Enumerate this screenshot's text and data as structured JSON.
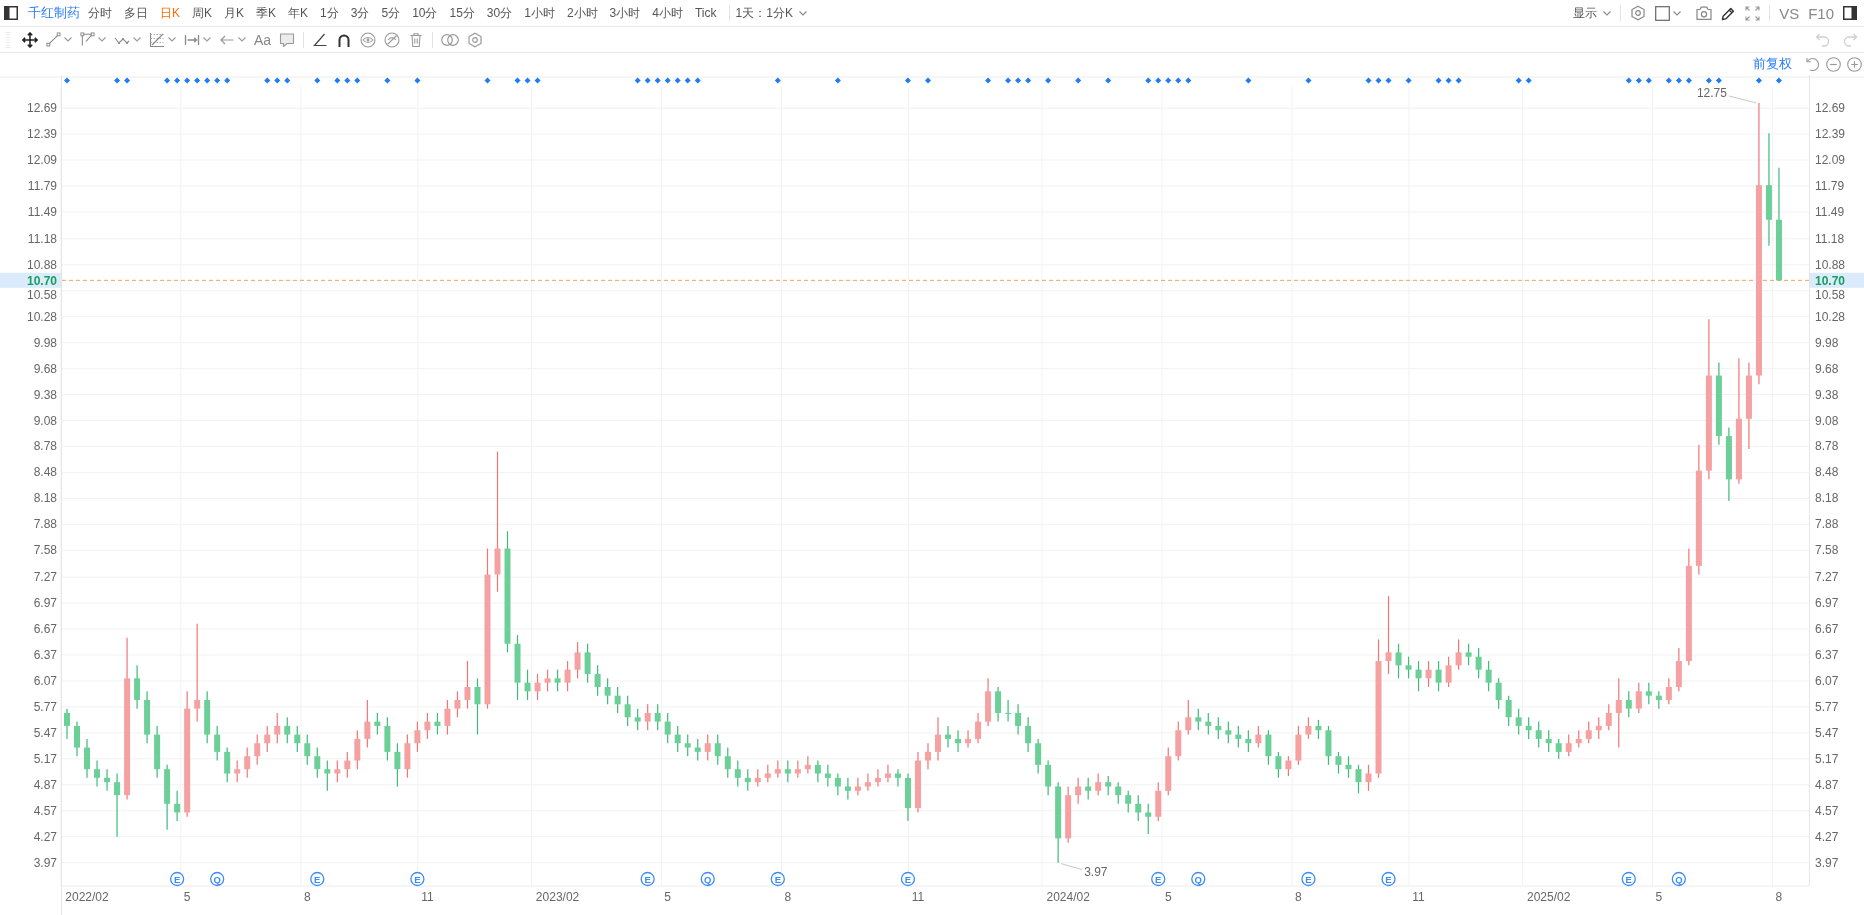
{
  "toolbar": {
    "stock_name": "千红制药",
    "periods": [
      {
        "label": "分时",
        "selected": false
      },
      {
        "label": "多日",
        "selected": false
      },
      {
        "label": "日K",
        "selected": true
      },
      {
        "label": "周K",
        "selected": false
      },
      {
        "label": "月K",
        "selected": false
      },
      {
        "label": "季K",
        "selected": false
      },
      {
        "label": "年K",
        "selected": false
      },
      {
        "label": "1分",
        "selected": false
      },
      {
        "label": "3分",
        "selected": false
      },
      {
        "label": "5分",
        "selected": false
      },
      {
        "label": "10分",
        "selected": false
      },
      {
        "label": "15分",
        "selected": false
      },
      {
        "label": "30分",
        "selected": false
      },
      {
        "label": "1小时",
        "selected": false
      },
      {
        "label": "2小时",
        "selected": false
      },
      {
        "label": "3小时",
        "selected": false
      },
      {
        "label": "4小时",
        "selected": false
      },
      {
        "label": "Tick",
        "selected": false
      }
    ],
    "interval_select": "1天：1分K",
    "display_menu": "显示",
    "compare_label": "VS",
    "f10_label": "F10"
  },
  "drawing_toolbar": {
    "text_tool": "Aa",
    "undo": {
      "disabled": true
    },
    "redo": {
      "disabled": true
    }
  },
  "chart": {
    "adjustment": "前复权",
    "left_axis_labels": [
      "12.69",
      "12.39",
      "12.09",
      "11.79",
      "11.49",
      "11.18",
      "10.88",
      "10.58",
      "10.28",
      "9.98",
      "9.68",
      "9.38",
      "9.08",
      "8.78",
      "8.48",
      "8.18",
      "7.88",
      "7.58",
      "7.27",
      "6.97",
      "6.67",
      "6.37",
      "6.07",
      "5.77",
      "5.47",
      "5.17",
      "4.87",
      "4.57",
      "4.27",
      "3.97"
    ],
    "right_axis_labels": [
      "12.69",
      "12.39",
      "12.09",
      "11.79",
      "11.49",
      "11.18",
      "10.88",
      "10.58",
      "10.28",
      "9.98",
      "9.68",
      "9.38",
      "9.08",
      "8.78",
      "8.48",
      "8.18",
      "7.88",
      "7.58",
      "7.27",
      "6.97",
      "6.67",
      "6.37",
      "6.07",
      "5.77",
      "5.47",
      "5.17",
      "4.87",
      "4.57",
      "4.27",
      "3.97"
    ],
    "left_price_tag": "10.70",
    "right_price_tag": "10.70",
    "event_row": [
      {
        "dot": true
      },
      {
        "dot": false
      },
      {
        "dot": false
      },
      {
        "dot": false
      },
      {
        "dot": false
      },
      {
        "dot": true
      },
      {
        "dot": true
      },
      {
        "dot": false
      },
      {
        "dot": false
      },
      {
        "dot": false
      },
      {
        "dot": true
      },
      {
        "dot": true,
        "badge": "E"
      },
      {
        "dot": true
      },
      {
        "dot": true
      },
      {
        "dot": true
      },
      {
        "dot": true,
        "badge": "Q"
      },
      {
        "dot": true
      },
      {
        "dot": false
      },
      {
        "dot": false
      },
      {
        "dot": false
      },
      {
        "dot": true
      },
      {
        "dot": true
      },
      {
        "dot": true
      },
      {
        "dot": false
      },
      {
        "dot": false
      },
      {
        "dot": true,
        "badge": "E"
      },
      {
        "dot": false
      },
      {
        "dot": true
      },
      {
        "dot": true
      },
      {
        "dot": true
      },
      {
        "dot": false
      },
      {
        "dot": false
      },
      {
        "dot": true
      },
      {
        "dot": false
      },
      {
        "dot": false
      },
      {
        "dot": true,
        "badge": "E"
      },
      {
        "dot": false
      },
      {
        "dot": false
      },
      {
        "dot": false
      },
      {
        "dot": false
      },
      {
        "dot": false
      },
      {
        "dot": false
      },
      {
        "dot": true
      },
      {
        "dot": false
      },
      {
        "dot": false
      },
      {
        "dot": true
      },
      {
        "dot": true
      },
      {
        "dot": true
      },
      {
        "dot": false
      },
      {
        "dot": false
      },
      {
        "dot": false
      },
      {
        "dot": false
      },
      {
        "dot": false
      },
      {
        "dot": false
      },
      {
        "dot": false
      },
      {
        "dot": false
      },
      {
        "dot": false
      },
      {
        "dot": true
      },
      {
        "dot": true,
        "badge": "E"
      },
      {
        "dot": true
      },
      {
        "dot": true
      },
      {
        "dot": true
      },
      {
        "dot": true
      },
      {
        "dot": true
      },
      {
        "dot": false,
        "badge": "Q"
      },
      {
        "dot": false
      },
      {
        "dot": false
      },
      {
        "dot": false
      },
      {
        "dot": false
      },
      {
        "dot": false
      },
      {
        "dot": false
      },
      {
        "dot": true,
        "badge": "E"
      },
      {
        "dot": false
      },
      {
        "dot": false
      },
      {
        "dot": false
      },
      {
        "dot": false
      },
      {
        "dot": false
      },
      {
        "dot": true
      },
      {
        "dot": false
      },
      {
        "dot": false
      },
      {
        "dot": false
      },
      {
        "dot": false
      },
      {
        "dot": false
      },
      {
        "dot": false
      },
      {
        "dot": true,
        "badge": "E"
      },
      {
        "dot": false
      },
      {
        "dot": true
      },
      {
        "dot": false
      },
      {
        "dot": false
      },
      {
        "dot": false
      },
      {
        "dot": false
      },
      {
        "dot": false
      },
      {
        "dot": true
      },
      {
        "dot": false
      },
      {
        "dot": true
      },
      {
        "dot": true
      },
      {
        "dot": true
      },
      {
        "dot": false
      },
      {
        "dot": true
      },
      {
        "dot": false
      },
      {
        "dot": false
      },
      {
        "dot": true
      },
      {
        "dot": false
      },
      {
        "dot": false
      },
      {
        "dot": true
      },
      {
        "dot": false
      },
      {
        "dot": false
      },
      {
        "dot": false
      },
      {
        "dot": true
      },
      {
        "dot": true,
        "badge": "E"
      },
      {
        "dot": true
      },
      {
        "dot": true
      },
      {
        "dot": true
      },
      {
        "dot": false,
        "badge": "Q"
      },
      {
        "dot": false
      },
      {
        "dot": false
      },
      {
        "dot": false
      },
      {
        "dot": false
      },
      {
        "dot": true
      },
      {
        "dot": false
      },
      {
        "dot": false
      },
      {
        "dot": false
      },
      {
        "dot": false
      },
      {
        "dot": false
      },
      {
        "dot": true,
        "badge": "E"
      },
      {
        "dot": false
      },
      {
        "dot": false
      },
      {
        "dot": false
      },
      {
        "dot": false
      },
      {
        "dot": false
      },
      {
        "dot": true
      },
      {
        "dot": true
      },
      {
        "dot": true,
        "badge": "E"
      },
      {
        "dot": false
      },
      {
        "dot": true
      },
      {
        "dot": false
      },
      {
        "dot": false
      },
      {
        "dot": true
      },
      {
        "dot": true
      },
      {
        "dot": true
      },
      {
        "dot": false
      },
      {
        "dot": false
      },
      {
        "dot": false
      },
      {
        "dot": false
      },
      {
        "dot": false
      },
      {
        "dot": true
      },
      {
        "dot": true
      },
      {
        "dot": false
      },
      {
        "dot": false
      },
      {
        "dot": false
      },
      {
        "dot": false
      },
      {
        "dot": false
      },
      {
        "dot": false
      },
      {
        "dot": false
      },
      {
        "dot": false
      },
      {
        "dot": false
      },
      {
        "dot": true,
        "badge": "E"
      },
      {
        "dot": true
      },
      {
        "dot": true
      },
      {
        "dot": false
      },
      {
        "dot": true
      },
      {
        "dot": true,
        "badge": "Q"
      },
      {
        "dot": true
      },
      {
        "dot": false
      },
      {
        "dot": true
      },
      {
        "dot": true
      },
      {
        "dot": false
      },
      {
        "dot": false
      },
      {
        "dot": false
      },
      {
        "dot": true
      },
      {
        "dot": false
      },
      {
        "dot": true
      }
    ],
    "chart_data": {
      "type": "candlestick",
      "grid": true,
      "ylim": [
        3.7,
        13.05
      ],
      "yticks": [
        12.69,
        12.39,
        12.09,
        11.79,
        11.49,
        11.18,
        10.88,
        10.58,
        10.28,
        9.98,
        9.68,
        9.38,
        9.08,
        8.78,
        8.48,
        8.18,
        7.88,
        7.58,
        7.27,
        6.97,
        6.67,
        6.37,
        6.07,
        5.77,
        5.47,
        5.17,
        4.87,
        4.57,
        4.27,
        3.97
      ],
      "categories": [
        null,
        null,
        "2022/02",
        null,
        null,
        null,
        null,
        null,
        null,
        null,
        null,
        null,
        "5",
        null,
        null,
        null,
        null,
        null,
        null,
        null,
        null,
        null,
        null,
        null,
        "8",
        null,
        null,
        null,
        null,
        null,
        null,
        null,
        null,
        null,
        null,
        null,
        "11",
        null,
        null,
        null,
        null,
        null,
        null,
        null,
        null,
        null,
        null,
        null,
        null,
        "2023/02",
        null,
        null,
        null,
        null,
        null,
        null,
        null,
        null,
        null,
        null,
        "5",
        null,
        null,
        null,
        null,
        null,
        null,
        null,
        null,
        null,
        null,
        null,
        "8",
        null,
        null,
        null,
        null,
        null,
        null,
        null,
        null,
        null,
        null,
        null,
        null,
        "11",
        null,
        null,
        null,
        null,
        null,
        null,
        null,
        null,
        null,
        null,
        null,
        null,
        null,
        null,
        "2024/02",
        null,
        null,
        null,
        null,
        null,
        null,
        null,
        null,
        null,
        "5",
        null,
        null,
        null,
        null,
        null,
        null,
        null,
        null,
        null,
        null,
        null,
        null,
        "8",
        null,
        null,
        null,
        null,
        null,
        null,
        null,
        null,
        null,
        null,
        null,
        "11",
        null,
        null,
        null,
        null,
        null,
        null,
        null,
        null,
        null,
        null,
        null,
        null,
        "2025/02",
        null,
        null,
        null,
        null,
        null,
        null,
        null,
        null,
        null,
        null,
        "5",
        null,
        null,
        null,
        null,
        null,
        null,
        null,
        null,
        null,
        null,
        null,
        "8"
      ],
      "ohlc": [
        [
          5.7,
          5.75,
          5.4,
          5.55
        ],
        [
          5.55,
          5.6,
          5.2,
          5.3
        ],
        [
          5.3,
          5.4,
          4.95,
          5.05
        ],
        [
          5.05,
          5.15,
          4.85,
          4.95
        ],
        [
          4.95,
          5.05,
          4.8,
          4.9
        ],
        [
          4.9,
          5.0,
          4.27,
          4.75
        ],
        [
          4.75,
          6.57,
          4.7,
          6.1
        ],
        [
          6.1,
          6.25,
          5.75,
          5.85
        ],
        [
          5.85,
          5.95,
          5.35,
          5.45
        ],
        [
          5.45,
          5.55,
          4.95,
          5.05
        ],
        [
          5.05,
          5.1,
          4.35,
          4.65
        ],
        [
          4.65,
          4.8,
          4.45,
          4.55
        ],
        [
          4.55,
          5.95,
          4.5,
          5.75
        ],
        [
          5.75,
          6.73,
          5.6,
          5.85
        ],
        [
          5.85,
          5.95,
          5.35,
          5.45
        ],
        [
          5.45,
          5.55,
          5.15,
          5.25
        ],
        [
          5.25,
          5.3,
          4.9,
          5.0
        ],
        [
          5.0,
          5.15,
          4.9,
          5.05
        ],
        [
          5.05,
          5.3,
          4.95,
          5.2
        ],
        [
          5.2,
          5.45,
          5.1,
          5.35
        ],
        [
          5.35,
          5.55,
          5.25,
          5.45
        ],
        [
          5.45,
          5.7,
          5.35,
          5.55
        ],
        [
          5.55,
          5.65,
          5.35,
          5.45
        ],
        [
          5.45,
          5.55,
          5.25,
          5.35
        ],
        [
          5.35,
          5.45,
          5.1,
          5.2
        ],
        [
          5.2,
          5.3,
          4.95,
          5.05
        ],
        [
          5.05,
          5.15,
          4.8,
          5.0
        ],
        [
          5.0,
          5.15,
          4.9,
          5.05
        ],
        [
          5.05,
          5.25,
          4.95,
          5.15
        ],
        [
          5.15,
          5.5,
          5.05,
          5.4
        ],
        [
          5.4,
          5.85,
          5.3,
          5.6
        ],
        [
          5.6,
          5.7,
          5.45,
          5.55
        ],
        [
          5.55,
          5.65,
          5.15,
          5.25
        ],
        [
          5.25,
          5.35,
          4.85,
          5.05
        ],
        [
          5.05,
          5.45,
          4.95,
          5.35
        ],
        [
          5.35,
          5.6,
          5.25,
          5.5
        ],
        [
          5.5,
          5.7,
          5.4,
          5.6
        ],
        [
          5.6,
          5.7,
          5.45,
          5.55
        ],
        [
          5.55,
          5.85,
          5.45,
          5.75
        ],
        [
          5.75,
          5.95,
          5.65,
          5.85
        ],
        [
          5.85,
          6.3,
          5.75,
          6.0
        ],
        [
          6.0,
          6.1,
          5.45,
          5.8
        ],
        [
          5.8,
          7.6,
          5.75,
          7.3
        ],
        [
          7.3,
          8.72,
          7.1,
          7.6
        ],
        [
          7.6,
          7.8,
          6.4,
          6.5
        ],
        [
          6.5,
          6.6,
          5.85,
          6.05
        ],
        [
          6.05,
          6.2,
          5.85,
          5.95
        ],
        [
          5.95,
          6.15,
          5.85,
          6.05
        ],
        [
          6.05,
          6.2,
          5.95,
          6.1
        ],
        [
          6.1,
          6.2,
          5.95,
          6.05
        ],
        [
          6.05,
          6.3,
          5.95,
          6.2
        ],
        [
          6.2,
          6.52,
          6.1,
          6.4
        ],
        [
          6.4,
          6.5,
          6.05,
          6.15
        ],
        [
          6.15,
          6.25,
          5.9,
          6.0
        ],
        [
          6.0,
          6.1,
          5.8,
          5.9
        ],
        [
          5.9,
          6.0,
          5.7,
          5.8
        ],
        [
          5.8,
          5.9,
          5.55,
          5.65
        ],
        [
          5.65,
          5.75,
          5.5,
          5.6
        ],
        [
          5.6,
          5.8,
          5.5,
          5.7
        ],
        [
          5.7,
          5.8,
          5.5,
          5.6
        ],
        [
          5.6,
          5.7,
          5.35,
          5.45
        ],
        [
          5.45,
          5.55,
          5.25,
          5.35
        ],
        [
          5.35,
          5.45,
          5.2,
          5.3
        ],
        [
          5.3,
          5.4,
          5.15,
          5.25
        ],
        [
          5.25,
          5.45,
          5.15,
          5.35
        ],
        [
          5.35,
          5.45,
          5.1,
          5.2
        ],
        [
          5.2,
          5.3,
          4.95,
          5.05
        ],
        [
          5.05,
          5.15,
          4.85,
          4.95
        ],
        [
          4.95,
          5.05,
          4.8,
          4.9
        ],
        [
          4.9,
          5.05,
          4.85,
          4.95
        ],
        [
          4.95,
          5.1,
          4.9,
          5.0
        ],
        [
          5.0,
          5.15,
          4.95,
          5.05
        ],
        [
          5.05,
          5.15,
          4.9,
          5.0
        ],
        [
          5.0,
          5.15,
          4.95,
          5.05
        ],
        [
          5.05,
          5.2,
          5.0,
          5.1
        ],
        [
          5.1,
          5.15,
          4.9,
          5.0
        ],
        [
          5.0,
          5.1,
          4.85,
          4.95
        ],
        [
          4.95,
          5.0,
          4.75,
          4.85
        ],
        [
          4.85,
          4.95,
          4.7,
          4.8
        ],
        [
          4.8,
          4.95,
          4.75,
          4.85
        ],
        [
          4.85,
          5.0,
          4.8,
          4.9
        ],
        [
          4.9,
          5.05,
          4.85,
          4.95
        ],
        [
          4.95,
          5.1,
          4.9,
          5.0
        ],
        [
          5.0,
          5.05,
          4.85,
          4.95
        ],
        [
          4.95,
          5.0,
          4.45,
          4.6
        ],
        [
          4.6,
          5.25,
          4.55,
          5.15
        ],
        [
          5.15,
          5.35,
          5.05,
          5.25
        ],
        [
          5.25,
          5.65,
          5.15,
          5.45
        ],
        [
          5.45,
          5.55,
          5.3,
          5.4
        ],
        [
          5.4,
          5.5,
          5.25,
          5.35
        ],
        [
          5.35,
          5.5,
          5.3,
          5.4
        ],
        [
          5.4,
          5.7,
          5.35,
          5.6
        ],
        [
          5.6,
          6.1,
          5.55,
          5.95
        ],
        [
          5.95,
          6.0,
          5.6,
          5.7
        ],
        [
          5.7,
          5.85,
          5.6,
          5.7
        ],
        [
          5.7,
          5.8,
          5.45,
          5.55
        ],
        [
          5.55,
          5.65,
          5.25,
          5.35
        ],
        [
          5.35,
          5.4,
          5.0,
          5.1
        ],
        [
          5.1,
          5.15,
          4.75,
          4.85
        ],
        [
          4.85,
          4.9,
          3.97,
          4.25
        ],
        [
          4.25,
          4.85,
          4.2,
          4.75
        ],
        [
          4.75,
          4.95,
          4.65,
          4.85
        ],
        [
          4.85,
          4.95,
          4.7,
          4.8
        ],
        [
          4.8,
          5.0,
          4.75,
          4.9
        ],
        [
          4.9,
          4.97,
          4.75,
          4.85
        ],
        [
          4.85,
          4.9,
          4.65,
          4.75
        ],
        [
          4.75,
          4.8,
          4.55,
          4.65
        ],
        [
          4.65,
          4.75,
          4.45,
          4.55
        ],
        [
          4.55,
          4.65,
          4.3,
          4.5
        ],
        [
          4.5,
          4.9,
          4.45,
          4.8
        ],
        [
          4.8,
          5.3,
          4.75,
          5.2
        ],
        [
          5.2,
          5.6,
          5.15,
          5.5
        ],
        [
          5.5,
          5.85,
          5.45,
          5.65
        ],
        [
          5.65,
          5.75,
          5.5,
          5.6
        ],
        [
          5.6,
          5.7,
          5.45,
          5.55
        ],
        [
          5.55,
          5.65,
          5.4,
          5.5
        ],
        [
          5.5,
          5.6,
          5.35,
          5.45
        ],
        [
          5.45,
          5.55,
          5.3,
          5.4
        ],
        [
          5.4,
          5.5,
          5.25,
          5.35
        ],
        [
          5.35,
          5.55,
          5.3,
          5.45
        ],
        [
          5.45,
          5.5,
          5.1,
          5.2
        ],
        [
          5.2,
          5.25,
          4.95,
          5.05
        ],
        [
          5.05,
          5.2,
          4.97,
          5.15
        ],
        [
          5.15,
          5.55,
          5.1,
          5.45
        ],
        [
          5.45,
          5.65,
          5.4,
          5.55
        ],
        [
          5.55,
          5.62,
          5.4,
          5.5
        ],
        [
          5.5,
          5.55,
          5.1,
          5.2
        ],
        [
          5.2,
          5.25,
          5.0,
          5.1
        ],
        [
          5.1,
          5.2,
          4.95,
          5.05
        ],
        [
          5.05,
          5.1,
          4.77,
          4.9
        ],
        [
          4.9,
          5.1,
          4.8,
          5.0
        ],
        [
          5.0,
          6.55,
          4.95,
          6.3
        ],
        [
          6.3,
          7.05,
          6.15,
          6.4
        ],
        [
          6.4,
          6.5,
          6.1,
          6.25
        ],
        [
          6.25,
          6.35,
          6.1,
          6.2
        ],
        [
          6.2,
          6.3,
          5.95,
          6.1
        ],
        [
          6.1,
          6.3,
          6.0,
          6.2
        ],
        [
          6.2,
          6.3,
          5.95,
          6.05
        ],
        [
          6.05,
          6.35,
          6.0,
          6.25
        ],
        [
          6.25,
          6.55,
          6.2,
          6.4
        ],
        [
          6.4,
          6.5,
          6.25,
          6.35
        ],
        [
          6.35,
          6.45,
          6.1,
          6.2
        ],
        [
          6.2,
          6.3,
          5.95,
          6.05
        ],
        [
          6.05,
          6.1,
          5.75,
          5.85
        ],
        [
          5.85,
          5.9,
          5.55,
          5.65
        ],
        [
          5.65,
          5.75,
          5.45,
          5.55
        ],
        [
          5.55,
          5.65,
          5.4,
          5.5
        ],
        [
          5.5,
          5.6,
          5.3,
          5.4
        ],
        [
          5.4,
          5.5,
          5.25,
          5.35
        ],
        [
          5.35,
          5.4,
          5.17,
          5.25
        ],
        [
          5.25,
          5.45,
          5.2,
          5.35
        ],
        [
          5.35,
          5.5,
          5.3,
          5.4
        ],
        [
          5.4,
          5.6,
          5.35,
          5.5
        ],
        [
          5.5,
          5.65,
          5.4,
          5.55
        ],
        [
          5.55,
          5.8,
          5.5,
          5.7
        ],
        [
          5.7,
          6.1,
          5.3,
          5.85
        ],
        [
          5.85,
          5.95,
          5.65,
          5.75
        ],
        [
          5.75,
          6.05,
          5.7,
          5.95
        ],
        [
          5.95,
          6.05,
          5.8,
          5.9
        ],
        [
          5.9,
          5.95,
          5.75,
          5.85
        ],
        [
          5.85,
          6.1,
          5.8,
          6.0
        ],
        [
          6.0,
          6.45,
          5.95,
          6.3
        ],
        [
          6.3,
          7.6,
          6.25,
          7.4
        ],
        [
          7.4,
          8.8,
          7.3,
          8.5
        ],
        [
          8.5,
          10.25,
          8.4,
          9.6
        ],
        [
          9.6,
          9.75,
          8.8,
          8.9
        ],
        [
          8.9,
          9.0,
          8.15,
          8.4
        ],
        [
          8.4,
          9.8,
          8.35,
          9.1
        ],
        [
          9.1,
          9.75,
          8.75,
          9.6
        ],
        [
          9.6,
          12.75,
          9.5,
          11.8
        ],
        [
          11.8,
          12.4,
          11.1,
          11.4
        ],
        [
          11.4,
          12.0,
          10.7,
          10.7
        ]
      ],
      "ref_lines": [
        {
          "axis": "y",
          "value": 10.7
        }
      ],
      "annotations": [
        "12.75",
        "3.97"
      ]
    }
  }
}
